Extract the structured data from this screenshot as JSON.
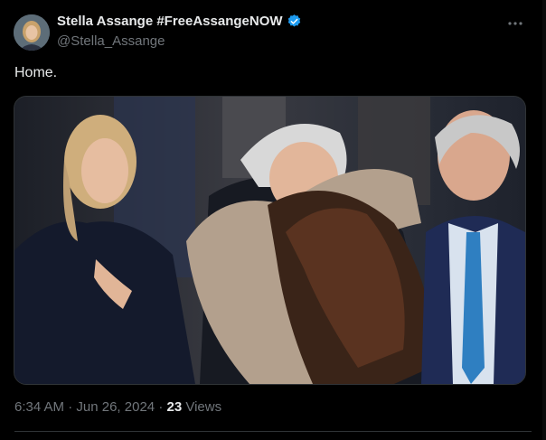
{
  "author": {
    "display_name": "Stella Assange #FreeAssangeNOW",
    "handle": "@Stella_Assange",
    "verified_color": "#1d9bf0"
  },
  "tweet": {
    "text": "Home."
  },
  "meta": {
    "time": "6:34 AM",
    "separator": "·",
    "date": "Jun 26, 2024",
    "views_count": "23",
    "views_label": "Views"
  },
  "icons": {
    "avatar": "avatar",
    "verified": "verified-badge-icon",
    "more": "more-icon"
  }
}
